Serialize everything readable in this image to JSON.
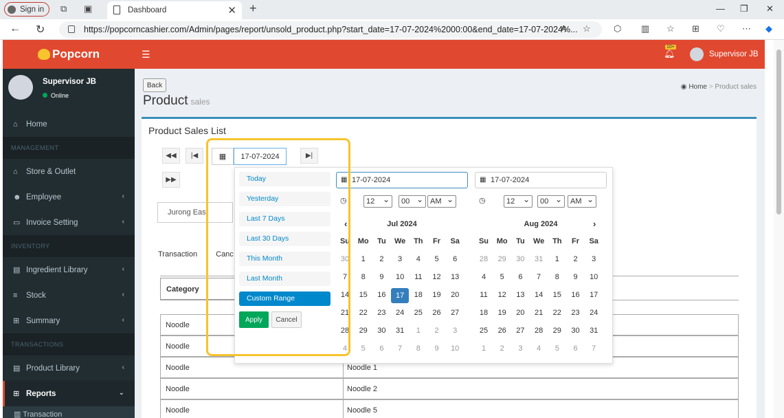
{
  "browser": {
    "signin": "Sign in",
    "tab_title": "Dashboard",
    "url": "https://popcorncashier.com/Admin/pages/report/unsold_product.php?start_date=17-07-2024%2000:00&end_date=17-07-2024%..."
  },
  "brand": {
    "name": "Popcorn"
  },
  "user": {
    "name": "Supervisor JB",
    "status": "Online"
  },
  "topbar": {
    "badge": "10+",
    "user": "Supervisor JB"
  },
  "sidebar": {
    "home": "Home",
    "management": "MANAGEMENT",
    "store": "Store & Outlet",
    "employee": "Employee",
    "invoice": "Invoice Setting",
    "inventory": "INVENTORY",
    "ingredient": "Ingredient Library",
    "stock": "Stock",
    "summary": "Summary",
    "transactions": "TRANSACTIONS",
    "product": "Product Library",
    "reports": "Reports",
    "transaction": "Transaction"
  },
  "page": {
    "back": "Back",
    "title": "Product",
    "subtitle": "sales",
    "crumb_home": "Home",
    "crumb_current": "Product sales",
    "box_title": "Product Sales List",
    "date": "17-07-2024",
    "outlet": "Jurong East",
    "tab1": "Transaction",
    "tab2": "Canc",
    "category_header": "Category"
  },
  "rows": [
    {
      "category": "Noodle",
      "product": ""
    },
    {
      "category": "Noodle",
      "product": ""
    },
    {
      "category": "Noodle",
      "product": "Noodle 1"
    },
    {
      "category": "Noodle",
      "product": "Noodle 2"
    },
    {
      "category": "Noodle",
      "product": "Noodle 5"
    }
  ],
  "picker": {
    "ranges": [
      "Today",
      "Yesterday",
      "Last 7 Days",
      "Last 30 Days",
      "This Month",
      "Last Month",
      "Custom Range"
    ],
    "apply": "Apply",
    "cancel": "Cancel",
    "start": "17-07-2024",
    "end": "17-07-2024",
    "hour": "12",
    "minute": "00",
    "ampm": "AM",
    "left_month": "Jul 2024",
    "right_month": "Aug 2024",
    "dow": [
      "Su",
      "Mo",
      "Tu",
      "We",
      "Th",
      "Fr",
      "Sa"
    ],
    "left_days": [
      "30",
      "1",
      "2",
      "3",
      "4",
      "5",
      "6",
      "7",
      "8",
      "9",
      "10",
      "11",
      "12",
      "13",
      "14",
      "15",
      "16",
      "17",
      "18",
      "19",
      "20",
      "21",
      "22",
      "23",
      "24",
      "25",
      "26",
      "27",
      "28",
      "29",
      "30",
      "31",
      "1",
      "2",
      "3",
      "4",
      "5",
      "6",
      "7",
      "8",
      "9",
      "10"
    ],
    "right_days": [
      "28",
      "29",
      "30",
      "31",
      "1",
      "2",
      "3",
      "4",
      "5",
      "6",
      "7",
      "8",
      "9",
      "10",
      "11",
      "12",
      "13",
      "14",
      "15",
      "16",
      "17",
      "18",
      "19",
      "20",
      "21",
      "22",
      "23",
      "24",
      "25",
      "26",
      "27",
      "28",
      "29",
      "30",
      "31",
      "1",
      "2",
      "3",
      "4",
      "5",
      "6",
      "7"
    ]
  }
}
